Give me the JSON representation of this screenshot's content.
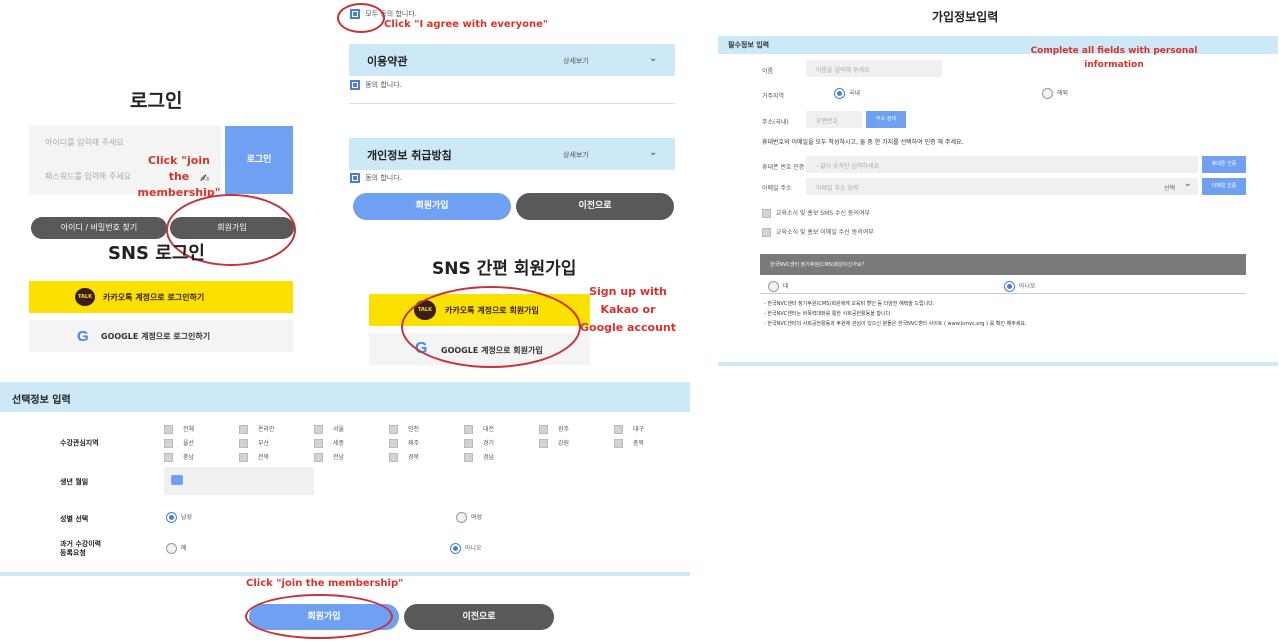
{
  "login": {
    "title": "로그인",
    "id_placeholder": "아이디를 입력해 주세요",
    "pw_placeholder": "패스워드를 입력해 주세요",
    "login_button": "로그인",
    "find_button": "아이디 / 비밀번호 찾기",
    "join_button": "회원가입",
    "sns_title": "SNS 로그인",
    "kakao_label": "카카오톡 계정으로 로그인하기",
    "talk_icon_text": "TALK",
    "google_label": "GOOGLE 계정으로 로그인하기",
    "annotation": "Click \"join the membership\""
  },
  "terms": {
    "agree_all": "모두 동의 합니다.",
    "annotation_agree": "Click \"I agree with everyone\"",
    "section1_title": "이용약관",
    "section1_detail": "상세보기",
    "section1_agree": "동의 합니다.",
    "section2_title": "개인정보 취급방침",
    "section2_detail": "상세보기",
    "section2_agree": "동의 합니다.",
    "join_button": "회원가입",
    "prev_button": "이전으로",
    "sns_title": "SNS 간편 회원가입",
    "kakao_label": "카카오톡 계정으로 회원가입",
    "google_label": "GOOGLE 계정으로 회원가입",
    "annotation_sns": "Sign up with Kakao or Google account"
  },
  "required": {
    "page_title": "가입정보입력",
    "section_title": "필수정보 입력",
    "annotation": "Complete all fields with personal information",
    "name_label": "이름",
    "name_placeholder": "이름을 입력해 주세요",
    "residence_label": "거주지역",
    "residence_opt1": "국내",
    "residence_opt2": "해외",
    "address_label": "주소(국내)",
    "zip_placeholder": "우편번호",
    "address_button": "주소 검색",
    "notice": "휴대번호와 이메일을 모두 작성하시고, 둘 중 한 가지를 선택하여 인증 해 주세요.",
    "phone_label": "휴대폰 번호 인증",
    "phone_placeholder": "- 없이 숫자만 입력하세요",
    "phone_button": "휴대폰 인증",
    "email_label": "이메일 주소",
    "email_placeholder": "이메일 주소 입력",
    "email_domain": "선택",
    "email_button": "이메일 인증",
    "sms_consent": "교육소식 및 홍보 SMS 수신 동의여부",
    "email_consent": "교육소식 및 홍보 이메일 수신 동의여부",
    "cms_question": "한국NVC센터 정기후원(CMS)회원이신가요?",
    "cms_yes": "네",
    "cms_no": "아니오",
    "note1": "- 한국NVC센터 정기후원(CMS)회원에게 교육비 할인 등 다양한 혜택을 드립니다.",
    "note2": "- 한국NVC센터는 비폭력대화를 통한 사회공헌활동을 합니다.",
    "note3": "- 한국NVC센터의 사회공헌활동과 후원에 관심이 있으신 분들은 한국NVC센터 사이트 ( www.krnvc.org ) 를 확인 해주세요."
  },
  "optional": {
    "section_title": "선택정보 입력",
    "region_label": "수강관심지역",
    "regions": [
      "전체",
      "온라인",
      "서울",
      "인천",
      "대전",
      "광주",
      "대구",
      "울산",
      "부산",
      "세종",
      "제주",
      "경기",
      "강원",
      "충북",
      "충남",
      "전북",
      "전남",
      "경북",
      "경남"
    ],
    "birth_label": "생년 월일",
    "gender_label": "성별 선택",
    "gender_male": "남성",
    "gender_female": "여성",
    "history_label_1": "과거 수강이력",
    "history_label_2": "등록요청",
    "history_yes": "예",
    "history_no": "아니오",
    "annotation": "Click \"join the membership\"",
    "join_button": "회원가입",
    "prev_button": "이전으로"
  },
  "colors": {
    "accent_blue": "#6fa0f1",
    "light_blue": "#cde8f7",
    "dark_gray": "#595959",
    "kakao_yellow": "#fae100",
    "annotation_red": "#d6332c"
  }
}
